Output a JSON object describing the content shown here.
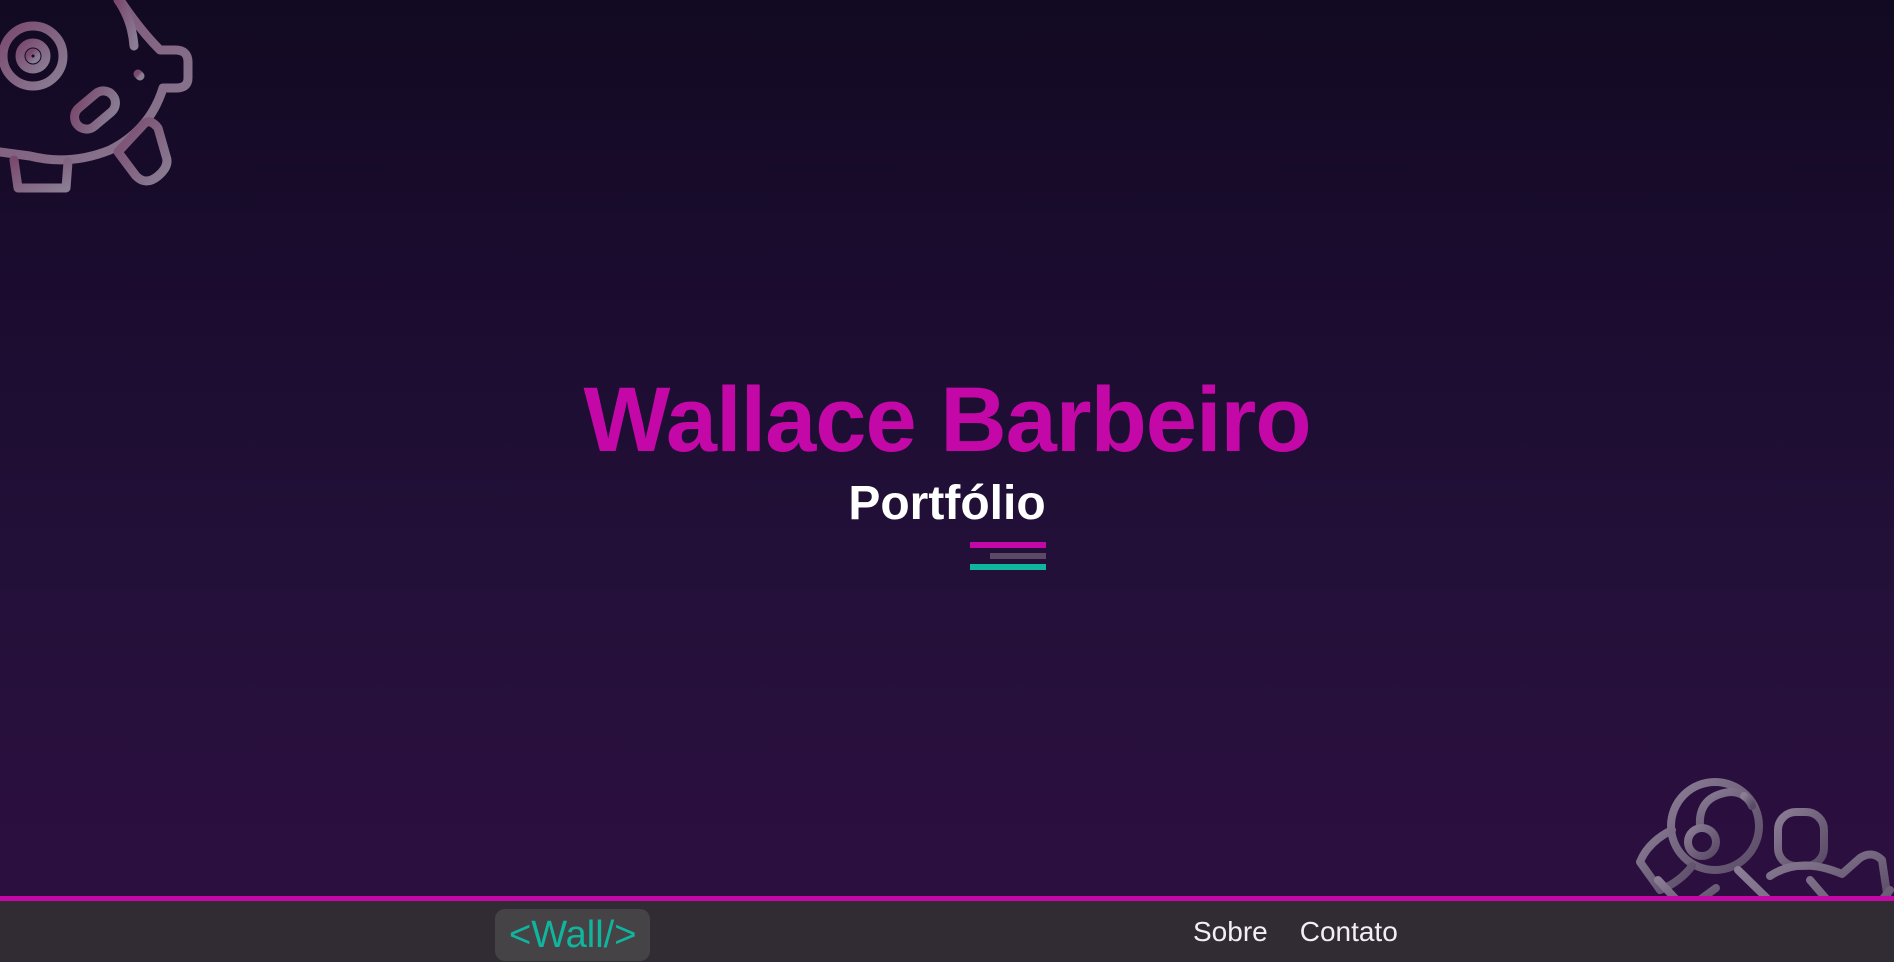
{
  "hero": {
    "title": "Wallace Barbeiro",
    "subtitle": "Portfólio"
  },
  "navbar": {
    "logo": "<Wall/>",
    "links": [
      {
        "label": "Sobre"
      },
      {
        "label": "Contato"
      }
    ]
  },
  "icons": {
    "top_left": "robot-icon",
    "bottom_right": "astronaut-icon"
  },
  "colors": {
    "accent": "#c408a8",
    "secondary": "#10b59e",
    "background_top": "#120a22",
    "background_bottom": "#2b0f3f",
    "navbar_background": "#312b33",
    "logo_background": "#454346",
    "underline_middle": "#5a4a66"
  }
}
